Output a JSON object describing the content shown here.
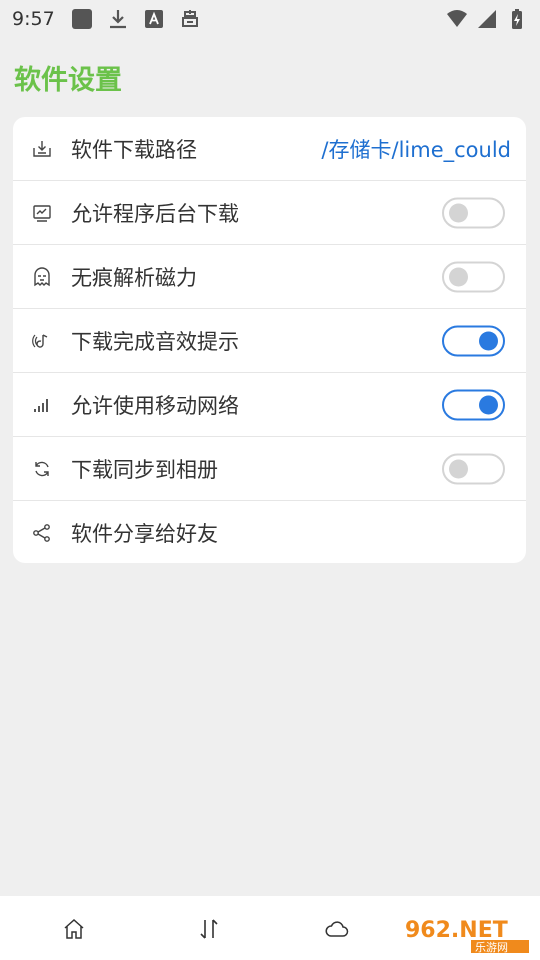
{
  "status_bar": {
    "time": "9:57"
  },
  "page": {
    "title": "软件设置"
  },
  "settings": [
    {
      "label": "软件下载路径",
      "icon": "download-tray-icon",
      "value": "/存储卡/lime_could"
    },
    {
      "label": "允许程序后台下载",
      "icon": "monitor-chart-icon",
      "toggle": false
    },
    {
      "label": "无痕解析磁力",
      "icon": "ghost-mask-icon",
      "toggle": false
    },
    {
      "label": "下载完成音效提示",
      "icon": "sound-wave-icon",
      "toggle": true
    },
    {
      "label": "允许使用移动网络",
      "icon": "signal-bars-icon",
      "toggle": true
    },
    {
      "label": "下载同步到相册",
      "icon": "sync-icon",
      "toggle": false
    },
    {
      "label": "软件分享给好友",
      "icon": "share-icon"
    }
  ],
  "bottom_nav": [
    {
      "name": "home-icon"
    },
    {
      "name": "transfer-arrows-icon"
    },
    {
      "name": "cloud-icon"
    }
  ],
  "watermark": {
    "text_top": "962.NET",
    "text_bottom": "乐游网"
  },
  "colors": {
    "accent_green": "#6bc24a",
    "accent_blue": "#2a7ae0",
    "path_blue": "#1e6fd0",
    "toggle_off": "#d4d4d4"
  }
}
